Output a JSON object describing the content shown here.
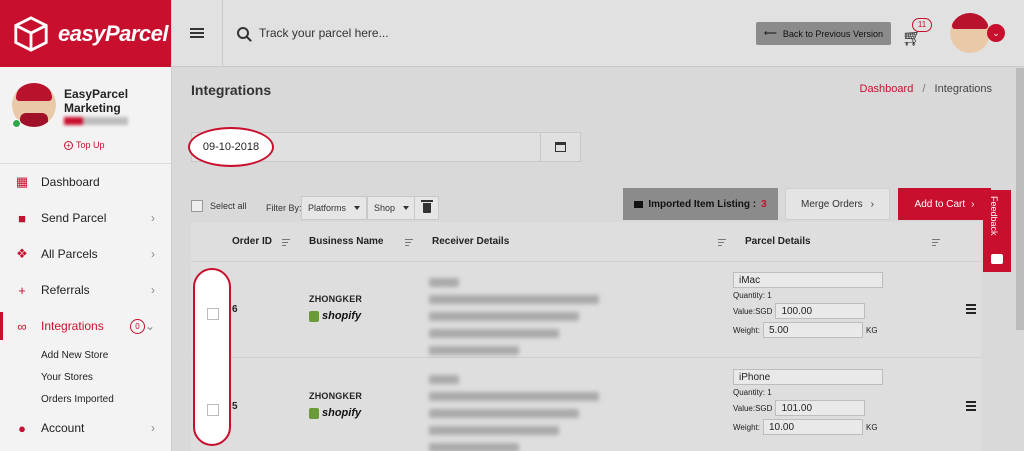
{
  "brand": {
    "name": "easyParcel"
  },
  "profile": {
    "name": "EasyParcel Marketing",
    "topup": "Top Up"
  },
  "nav": {
    "items": [
      {
        "label": "Dashboard",
        "icon": "dashboard-icon"
      },
      {
        "label": "Send Parcel",
        "icon": "truck-icon"
      },
      {
        "label": "All Parcels",
        "icon": "boxes-icon"
      },
      {
        "label": "Referrals",
        "icon": "user-plus-icon"
      },
      {
        "label": "Integrations",
        "icon": "link-icon",
        "badge": "0"
      },
      {
        "label": "Account",
        "icon": "user-icon"
      }
    ],
    "subitems": [
      "Add New Store",
      "Your Stores",
      "Orders Imported"
    ]
  },
  "topbar": {
    "search_placeholder": "Track your parcel here...",
    "back_label": "Back to Previous Version",
    "cart_count": "11"
  },
  "page": {
    "title": "Integrations",
    "breadcrumb": {
      "home": "Dashboard",
      "current": "Integrations",
      "sep": "/"
    }
  },
  "date_filter": {
    "value": "09-10-2018"
  },
  "toolbar": {
    "select_all": "Select all",
    "filter_by": "Filter By:",
    "platforms": "Platforms",
    "shop": "Shop",
    "imported_label": "Imported Item Listing :",
    "imported_count": "3",
    "merge_label": "Merge Orders",
    "add_to_cart_label": "Add to Cart"
  },
  "table": {
    "headers": [
      "Order ID",
      "Business Name",
      "Receiver Details",
      "Parcel Details"
    ],
    "rows": [
      {
        "order_id": "6",
        "business": "ZHONGKER",
        "platform": "shopify",
        "item": "iMac",
        "quantity": "Quantity: 1",
        "value_label": "Value:SGD",
        "value": "100.00",
        "weight_label": "Weight:",
        "weight": "5.00",
        "unit": "KG"
      },
      {
        "order_id": "5",
        "business": "ZHONGKER",
        "platform": "shopify",
        "item": "iPhone",
        "quantity": "Quantity: 1",
        "value_label": "Value:SGD",
        "value": "101.00",
        "weight_label": "Weight:",
        "weight": "10.00",
        "unit": "KG"
      }
    ]
  },
  "feedback": {
    "label": "Feedback"
  },
  "colors": {
    "brand": "#c8102e",
    "overlay": "#d9d9d9"
  }
}
